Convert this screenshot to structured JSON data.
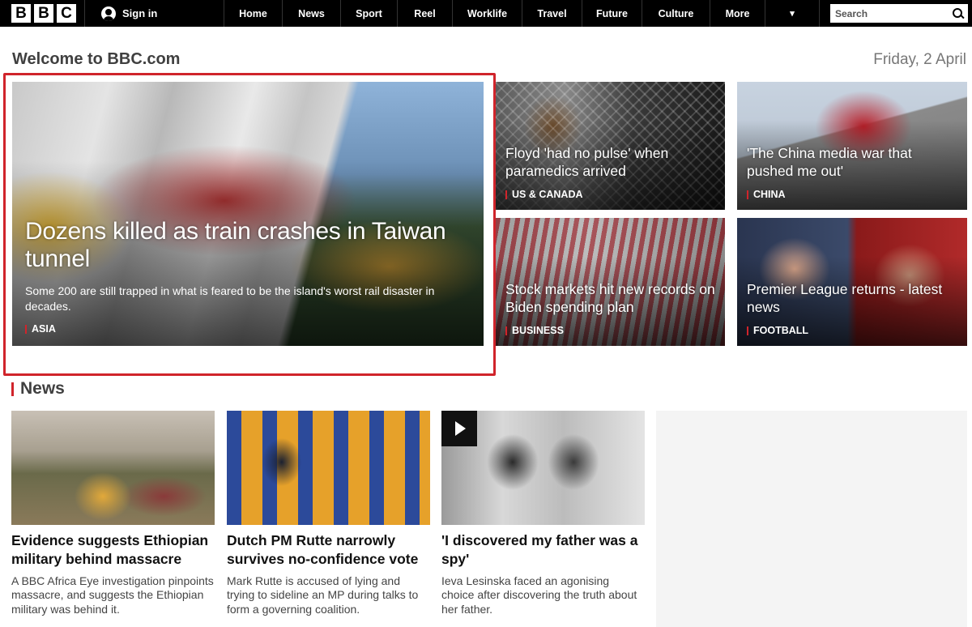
{
  "nav": {
    "logo_letters": [
      "B",
      "B",
      "C"
    ],
    "sign_in": "Sign in",
    "items": [
      "Home",
      "News",
      "Sport",
      "Reel",
      "Worklife",
      "Travel",
      "Future",
      "Culture",
      "More"
    ],
    "more_chevron": "▾",
    "search_placeholder": "Search"
  },
  "welcome": "Welcome to BBC.com",
  "date": "Friday, 2 April",
  "hero": {
    "headline": "Dozens killed as train crashes in Taiwan tunnel",
    "summary": "Some 200 are still trapped in what is feared to be the island's worst rail disaster in decades.",
    "tag": "ASIA"
  },
  "top_stories": [
    {
      "headline": "Floyd 'had no pulse' when paramedics arrived",
      "tag": "US & CANADA"
    },
    {
      "headline": "'The China media war that pushed me out'",
      "tag": "CHINA"
    },
    {
      "headline": "Stock markets hit new records on Biden spending plan",
      "tag": "BUSINESS"
    },
    {
      "headline": "Premier League returns - latest news",
      "tag": "FOOTBALL"
    }
  ],
  "news_section": {
    "heading": "News",
    "stories": [
      {
        "title": "Evidence suggests Ethiopian military behind massacre",
        "desc": "A BBC Africa Eye investigation pinpoints massacre, and suggests the Ethiopian military was behind it."
      },
      {
        "title": "Dutch PM Rutte narrowly survives no-confidence vote",
        "desc": "Mark Rutte is accused of lying and trying to sideline an MP during talks to form a governing coalition."
      },
      {
        "title": "'I discovered my father was a spy'",
        "desc": "Ieva Lesinska faced an agonising choice after discovering the truth about her father."
      }
    ]
  },
  "colors": {
    "accent_red": "#d0242b",
    "nav_bg": "#000000"
  }
}
